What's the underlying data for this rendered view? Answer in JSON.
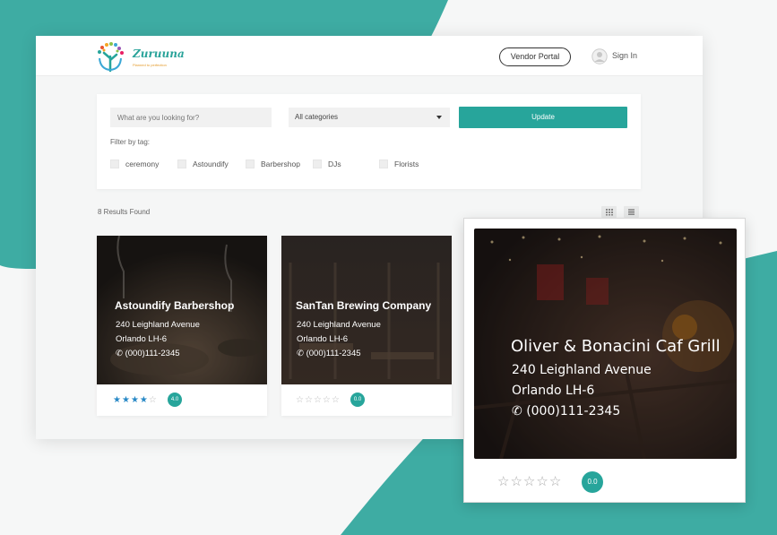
{
  "colors": {
    "accent": "#27a59b",
    "star_active": "#2788c6",
    "background_shape": "#3eaca3"
  },
  "header": {
    "logo_name": "Zuruuna",
    "logo_tagline": "Planned to perfection",
    "vendor_portal_label": "Vendor Portal",
    "sign_in_label": "Sign In",
    "avatar_icon": "user-circle-icon"
  },
  "search": {
    "placeholder": "What are you looking for?",
    "category_value": "All categories",
    "update_label": "Update",
    "filter_label": "Filter by tag:",
    "tags": [
      "ceremony",
      "Astoundify",
      "Barbershop",
      "DJs",
      "Florists"
    ]
  },
  "results": {
    "count_text": "8 Results Found",
    "view_icons": [
      "grid-view-icon",
      "list-view-icon"
    ]
  },
  "listings": [
    {
      "title": "Astoundify Barbershop",
      "address": "240 Leighland Avenue",
      "city": "Orlando LH-6",
      "phone": "(000)111-2345",
      "rating_value": 4,
      "rating_label": "4.0"
    },
    {
      "title": "SanTan Brewing Company",
      "address": "240 Leighland Avenue",
      "city": "Orlando LH-6",
      "phone": "(000)111-2345",
      "rating_value": 0,
      "rating_label": "0.0"
    }
  ],
  "featured": {
    "title": "Oliver & Bonacini Caf Grill",
    "address": "240 Leighland Avenue",
    "city": "Orlando LH-6",
    "phone": "(000)111-2345",
    "rating_value": 0,
    "rating_label": "0.0"
  }
}
